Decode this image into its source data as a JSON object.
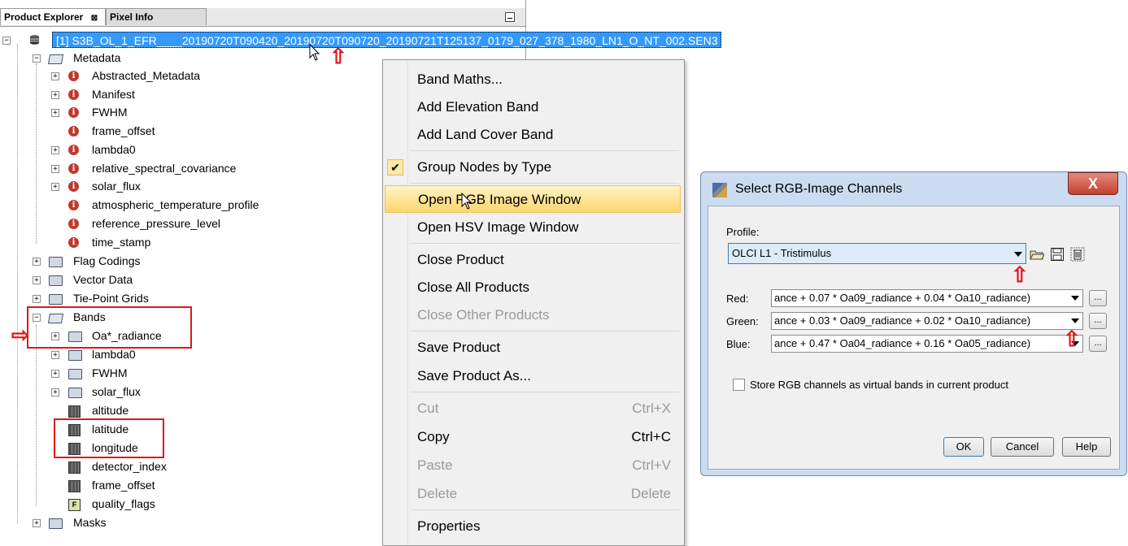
{
  "tabs": [
    {
      "label": "Product Explorer",
      "close": "⊠"
    },
    {
      "label": "Pixel Info"
    }
  ],
  "product": {
    "label": "[1] S3B_OL_1_EFR____20190720T090420_20190720T090720_20190721T125137_0179_027_378_1980_LN1_O_NT_002.SEN3"
  },
  "tree": {
    "metadata": "Metadata",
    "metadata_items": [
      "Abstracted_Metadata",
      "Manifest",
      "FWHM",
      "frame_offset",
      "lambda0",
      "relative_spectral_covariance",
      "solar_flux",
      "atmospheric_temperature_profile",
      "reference_pressure_level",
      "time_stamp"
    ],
    "flag_codings": "Flag Codings",
    "vector_data": "Vector Data",
    "tie_point_grids": "Tie-Point Grids",
    "bands": "Bands",
    "band_groups": [
      "Oa*_radiance",
      "lambda0",
      "FWHM",
      "solar_flux"
    ],
    "band_items": [
      "altitude",
      "latitude",
      "longitude",
      "detector_index",
      "frame_offset",
      "quality_flags"
    ],
    "masks": "Masks"
  },
  "context_menu": {
    "items": [
      {
        "label": "Band Maths...",
        "enabled": true
      },
      {
        "label": "Add Elevation Band",
        "enabled": true
      },
      {
        "label": "Add Land Cover Band",
        "enabled": true
      },
      {
        "label": "Group Nodes by Type",
        "enabled": true,
        "checked": true
      },
      {
        "label": "Open RGB Image Window",
        "enabled": true,
        "highlighted": true
      },
      {
        "label": "Open HSV Image Window",
        "enabled": true
      },
      {
        "label": "Close Product",
        "enabled": true
      },
      {
        "label": "Close All Products",
        "enabled": true
      },
      {
        "label": "Close Other Products",
        "enabled": false
      },
      {
        "label": "Save Product",
        "enabled": true
      },
      {
        "label": "Save Product As...",
        "enabled": true
      },
      {
        "label": "Cut",
        "shortcut": "Ctrl+X",
        "enabled": false
      },
      {
        "label": "Copy",
        "shortcut": "Ctrl+C",
        "enabled": true
      },
      {
        "label": "Paste",
        "shortcut": "Ctrl+V",
        "enabled": false
      },
      {
        "label": "Delete",
        "shortcut": "Delete",
        "enabled": false
      },
      {
        "label": "Properties",
        "enabled": true
      }
    ]
  },
  "dialog": {
    "title": "Select RGB-Image Channels",
    "close": "X",
    "profile_label": "Profile:",
    "profile_value": "OLCI L1 - Tristimulus",
    "red_label": "Red:",
    "red_value": "ance + 0.07 * Oa09_radiance + 0.04 * Oa10_radiance)",
    "green_label": "Green:",
    "green_value": "ance + 0.03 * Oa09_radiance + 0.02 * Oa10_radiance)",
    "blue_label": "Blue:",
    "blue_value": "ance + 0.47 * Oa04_radiance + 0.16 * Oa05_radiance)",
    "dots": "...",
    "store_label": "Store RGB channels as virtual bands in current product",
    "ok": "OK",
    "cancel": "Cancel",
    "help": "Help"
  },
  "colors": {
    "highlight": "#3399ff",
    "annotation": "#e0161c",
    "menu_hover": "#fcd76b"
  }
}
